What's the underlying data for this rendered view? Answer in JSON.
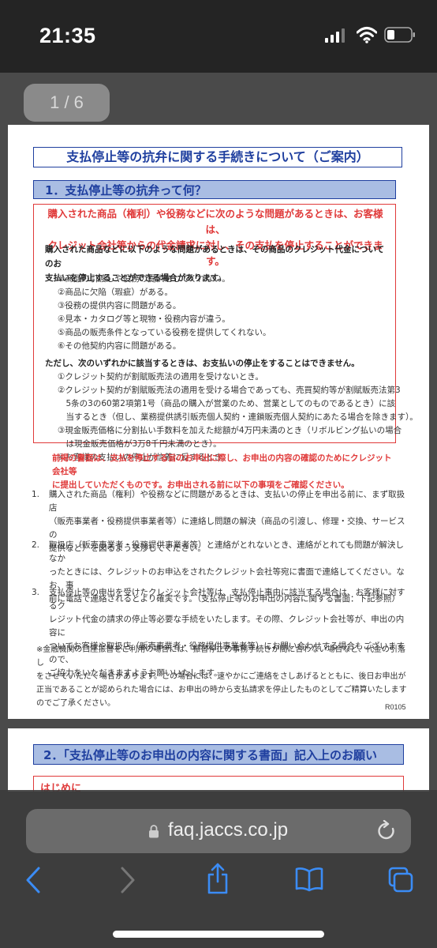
{
  "status_bar": {
    "time": "21:35"
  },
  "pdf_viewer": {
    "page_counter": "1 / 6"
  },
  "document": {
    "title": "支払停止等の抗弁に関する手続きについて（ご案内）",
    "section1": {
      "heading": "1．支払停止等の抗弁って何？",
      "red_intro_1": "購入された商品（権利）や役務などに次のような問題があるときは、お客様は、",
      "red_intro_2": "クレジット会社等からの代金請求に対し、その支払を停止することができます。",
      "para1_1": "購入された商品などに以下のような問題があるときは、その商品のクレジット代金についてのお",
      "para1_2": "支払いを停止することができる場合があります。",
      "list1": [
        "①商品の引渡しや役務の提供をしてくれない。",
        "②商品に欠陥（瑕疵）がある。",
        "③役務の提供内容に問題がある。",
        "④見本・カタログ等と現物・役務内容が違う。",
        "⑤商品の販売条件となっている役務を提供してくれない。",
        "⑥その他契約内容に問題がある。"
      ],
      "para2": "ただし、次のいずれかに該当するときは、お支払いの停止をすることはできません。",
      "list2": [
        "①クレジット契約が割賦販売法の適用を受けないとき。",
        "②クレジット契約が割賦販売法の適用を受ける場合であっても、売買契約等が割賦販売法第3",
        "　5条の3の60第2項第1号（商品の購入が営業のため、営業としてのものであるとき）に該",
        "　当するとき（但し、業務提供誘引販売個人契約・連鎖販売個人契約にあたる場合を除きます）。",
        "③現金販売価格に分割払い手数料を加えた総額が4万円未満のとき（リボルビング払いの場合",
        "　は現金販売価格が3万8千円未満のとき）。",
        "④お客様の支払いの停止が信義に反するとき。"
      ]
    },
    "red_note_1": "前掲の書面は、支払を停止する旨のお申出に際し、お申出の内容の確認のためにクレジット会社等",
    "red_note_2": "に提出していただくものです。お申出される前に以下の事項をご確認ください。",
    "items": [
      {
        "num": "1.",
        "lines": [
          "購入された商品（権利）や役務などに問題があるときは、支払いの停止を申出る前に、まず取扱店",
          "（販売事業者・役務提供事業者等）に連絡し問題の解決（商品の引渡し、修理・交換、サービスの",
          "提供など）を図るよう交渉してください。"
        ]
      },
      {
        "num": "2.",
        "lines": [
          "取扱店（販売事業者・役務提供事業者等）と連絡がとれないとき、連絡がとれても問題が解決しなか",
          "ったときには、クレジットのお申込をされたクレジット会社等宛に書面で連絡してください。なお、事",
          "前に電話で連絡されるとより確実です。（支払停止等のお申出の内容に関する書面：下記参照）"
        ]
      },
      {
        "num": "3.",
        "lines": [
          "支払停止等の申出を受けたクレジット会社等は、支払停止事由に該当する場合は、お客様に対するク",
          "レジット代金の請求の停止等必要な手続をいたします。その際、クレジット会社等が、申出の内容に",
          "ついてお客様や取扱店（販売事業者・役務提供事業者等）にお問い合わせする場合もございますので、",
          "ご協力をいただきますようお願いいたします。"
        ]
      }
    ],
    "footnote": [
      "※金融機関の口座振替をご利用の場合には、振替停止の事務手続きが間に合わない場合など、代金の引落し",
      "をさせていただく場合があります。この場合には、速やかにご連絡をさしあげるとともに、後日お申出が",
      "正当であることが認められた場合には、お申出の時から支払請求を停止したものとしてご精算いたします",
      "のでご了承ください。"
    ],
    "code": "R0105",
    "section2_heading": "2．「支払停止等のお申出の内容に関する書面」記入上のお願い",
    "intro_label": "はじめに"
  },
  "browser": {
    "url": "faq.jaccs.co.jp"
  }
}
